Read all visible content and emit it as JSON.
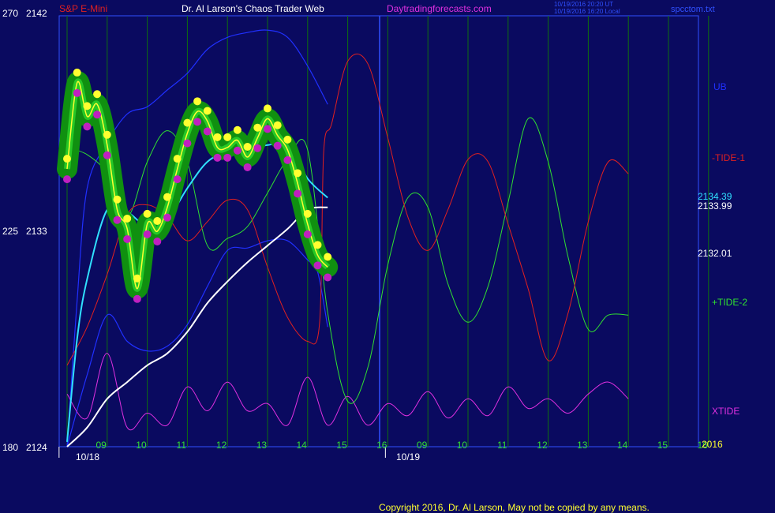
{
  "header": {
    "symbol": "S&P E-Mini",
    "title": "Dr. Al Larson's Chaos Trader Web",
    "site": "Daytradingforecasts.com",
    "ts_line1": "10/19/2016 20:20 UT",
    "ts_line2": "10/19/2016 16:20 Local",
    "file": "spcctom.txt"
  },
  "footer": {
    "copyright": "Copyright 2016, Dr. Al Larson, May not be copied by any means."
  },
  "colors": {
    "background": "#0a0a60",
    "frame": "#3050ff",
    "grid": "#0f6f0f",
    "tide1": "#e02020",
    "tide2": "#30e030",
    "xtide": "#e030e0",
    "band": "#2030ff",
    "cyan_avg": "#30e0ff",
    "white_avg": "#ffffff",
    "yellow": "#ffff30"
  },
  "chart_data": {
    "type": "line",
    "title": "S&P E-Mini",
    "left_axis": {
      "ticks": [
        {
          "index": "270",
          "price": "2142",
          "value": 2142
        },
        {
          "index": "225",
          "price": "2133",
          "value": 2133
        },
        {
          "index": "180",
          "price": "2124",
          "value": 2124
        }
      ],
      "ylim": [
        2124,
        2142
      ]
    },
    "x_hours": [
      "09",
      "10",
      "11",
      "12",
      "13",
      "14",
      "15",
      "16",
      "09",
      "10",
      "11",
      "12",
      "13",
      "14",
      "15",
      "16"
    ],
    "x_dates": [
      "10/18",
      "10/19"
    ],
    "year": "2016",
    "right_labels": {
      "ub": "UB",
      "tide1": "-TIDE-1",
      "price1": "2134.39",
      "price2": "2133.99",
      "price3": "2132.01",
      "tide2": "+TIDE-2",
      "xtide": "XTIDE"
    },
    "series": [
      {
        "name": "S&P E-Mini",
        "points": [
          [
            0.0,
            2135.6
          ],
          [
            0.25,
            2139.2
          ],
          [
            0.5,
            2137.8
          ],
          [
            0.75,
            2138.3
          ],
          [
            1.0,
            2136.6
          ],
          [
            1.25,
            2133.9
          ],
          [
            1.5,
            2133.1
          ],
          [
            1.75,
            2130.6
          ],
          [
            2.0,
            2133.3
          ],
          [
            2.25,
            2133.0
          ],
          [
            2.5,
            2134.0
          ],
          [
            2.75,
            2135.6
          ],
          [
            3.0,
            2137.1
          ],
          [
            3.25,
            2138.0
          ],
          [
            3.5,
            2137.6
          ],
          [
            3.75,
            2136.5
          ],
          [
            4.0,
            2136.5
          ],
          [
            4.25,
            2136.8
          ],
          [
            4.5,
            2136.1
          ],
          [
            4.75,
            2136.9
          ],
          [
            5.0,
            2137.7
          ],
          [
            5.25,
            2137.0
          ],
          [
            5.5,
            2136.4
          ],
          [
            5.75,
            2135.0
          ],
          [
            6.0,
            2133.3
          ],
          [
            6.25,
            2132.0
          ],
          [
            6.5,
            2131.5
          ]
        ]
      },
      {
        "name": "-TIDE-1",
        "points": [
          [
            0.0,
            2127.4
          ],
          [
            0.5,
            2129.0
          ],
          [
            1.0,
            2131.2
          ],
          [
            1.5,
            2133.7
          ],
          [
            2.0,
            2134.1
          ],
          [
            2.5,
            2133.6
          ],
          [
            3.0,
            2132.6
          ],
          [
            3.5,
            2133.4
          ],
          [
            4.0,
            2134.3
          ],
          [
            4.5,
            2133.9
          ],
          [
            5.0,
            2131.5
          ],
          [
            5.5,
            2129.4
          ],
          [
            6.0,
            2128.4
          ],
          [
            6.3,
            2129.2
          ],
          [
            6.4,
            2136.3
          ],
          [
            6.6,
            2137.5
          ],
          [
            7.0,
            2140.1
          ],
          [
            7.5,
            2140.0
          ],
          [
            8.0,
            2136.9
          ],
          [
            8.5,
            2133.6
          ],
          [
            9.0,
            2132.2
          ],
          [
            9.5,
            2133.9
          ],
          [
            10.0,
            2136.0
          ],
          [
            10.5,
            2135.9
          ],
          [
            11.0,
            2133.3
          ],
          [
            11.5,
            2130.6
          ],
          [
            12.0,
            2127.6
          ],
          [
            12.5,
            2129.6
          ],
          [
            13.0,
            2133.4
          ],
          [
            13.5,
            2135.9
          ],
          [
            14.0,
            2135.4
          ]
        ]
      },
      {
        "name": "+TIDE-2",
        "points": [
          [
            0.0,
            2136.5
          ],
          [
            0.5,
            2136.2
          ],
          [
            1.0,
            2135.4
          ],
          [
            1.5,
            2133.6
          ],
          [
            2.0,
            2135.9
          ],
          [
            2.5,
            2137.2
          ],
          [
            3.0,
            2135.9
          ],
          [
            3.5,
            2132.4
          ],
          [
            4.0,
            2132.7
          ],
          [
            4.5,
            2133.2
          ],
          [
            5.0,
            2134.6
          ],
          [
            5.5,
            2136.0
          ],
          [
            6.0,
            2136.4
          ],
          [
            6.5,
            2129.6
          ],
          [
            7.0,
            2125.9
          ],
          [
            7.5,
            2127.3
          ],
          [
            8.0,
            2131.6
          ],
          [
            8.5,
            2134.4
          ],
          [
            9.0,
            2134.0
          ],
          [
            9.5,
            2130.8
          ],
          [
            10.0,
            2129.2
          ],
          [
            10.5,
            2130.7
          ],
          [
            11.0,
            2134.2
          ],
          [
            11.5,
            2137.7
          ],
          [
            12.0,
            2135.9
          ],
          [
            12.5,
            2131.9
          ],
          [
            13.0,
            2128.9
          ],
          [
            13.5,
            2129.5
          ],
          [
            14.0,
            2129.5
          ]
        ]
      },
      {
        "name": "XTIDE",
        "points": [
          [
            0.0,
            2126.2
          ],
          [
            0.5,
            2125.2
          ],
          [
            1.0,
            2127.9
          ],
          [
            1.5,
            2124.8
          ],
          [
            2.0,
            2125.4
          ],
          [
            2.5,
            2124.9
          ],
          [
            3.0,
            2126.5
          ],
          [
            3.5,
            2125.5
          ],
          [
            4.0,
            2126.7
          ],
          [
            4.5,
            2125.5
          ],
          [
            5.0,
            2125.8
          ],
          [
            5.5,
            2124.9
          ],
          [
            6.0,
            2126.9
          ],
          [
            6.5,
            2124.9
          ],
          [
            7.0,
            2126.1
          ],
          [
            7.5,
            2124.9
          ],
          [
            8.0,
            2125.8
          ],
          [
            8.5,
            2125.3
          ],
          [
            9.0,
            2126.3
          ],
          [
            9.5,
            2125.2
          ],
          [
            10.0,
            2126.0
          ],
          [
            10.5,
            2125.3
          ],
          [
            11.0,
            2126.5
          ],
          [
            11.5,
            2125.6
          ],
          [
            12.0,
            2126.0
          ],
          [
            12.5,
            2125.4
          ],
          [
            13.0,
            2126.2
          ],
          [
            13.5,
            2126.7
          ],
          [
            14.0,
            2126.0
          ]
        ]
      },
      {
        "name": "UB",
        "points": [
          [
            0.0,
            2124.0
          ],
          [
            0.25,
            2130.1
          ],
          [
            0.5,
            2134.8
          ],
          [
            1.0,
            2136.7
          ],
          [
            1.5,
            2137.9
          ],
          [
            2.0,
            2138.2
          ],
          [
            2.5,
            2138.9
          ],
          [
            3.0,
            2139.6
          ],
          [
            3.5,
            2140.6
          ],
          [
            4.0,
            2141.1
          ],
          [
            4.5,
            2141.3
          ],
          [
            5.0,
            2141.4
          ],
          [
            5.5,
            2141.1
          ],
          [
            6.0,
            2139.9
          ],
          [
            6.5,
            2138.3
          ]
        ]
      },
      {
        "name": "LB",
        "points": [
          [
            0.0,
            2124.0
          ],
          [
            0.5,
            2127.0
          ],
          [
            1.0,
            2129.5
          ],
          [
            1.5,
            2128.4
          ],
          [
            2.0,
            2128.0
          ],
          [
            2.5,
            2128.2
          ],
          [
            3.0,
            2129.1
          ],
          [
            3.5,
            2130.7
          ],
          [
            4.0,
            2132.2
          ],
          [
            4.5,
            2132.3
          ],
          [
            5.0,
            2132.6
          ],
          [
            5.5,
            2132.6
          ],
          [
            6.0,
            2131.8
          ],
          [
            6.25,
            2131.3
          ],
          [
            6.5,
            2129.0
          ]
        ]
      },
      {
        "name": "cyan-average",
        "points": [
          [
            0.0,
            2124.2
          ],
          [
            0.25,
            2128.5
          ],
          [
            0.5,
            2131.0
          ],
          [
            1.0,
            2133.9
          ],
          [
            1.5,
            2133.8
          ],
          [
            2.0,
            2133.2
          ],
          [
            2.5,
            2133.5
          ],
          [
            3.0,
            2134.8
          ],
          [
            3.5,
            2135.9
          ],
          [
            4.0,
            2136.3
          ],
          [
            4.5,
            2136.4
          ],
          [
            5.0,
            2136.6
          ],
          [
            5.5,
            2136.6
          ],
          [
            6.0,
            2135.2
          ],
          [
            6.5,
            2134.4
          ]
        ]
      },
      {
        "name": "white-average",
        "points": [
          [
            0.0,
            2124.0
          ],
          [
            0.5,
            2124.8
          ],
          [
            1.0,
            2126.0
          ],
          [
            1.5,
            2126.7
          ],
          [
            2.0,
            2127.4
          ],
          [
            2.5,
            2127.9
          ],
          [
            3.0,
            2128.8
          ],
          [
            3.5,
            2130.0
          ],
          [
            4.0,
            2130.9
          ],
          [
            4.5,
            2131.7
          ],
          [
            5.0,
            2132.4
          ],
          [
            5.5,
            2133.1
          ],
          [
            6.0,
            2133.9
          ],
          [
            6.5,
            2134.0
          ]
        ]
      }
    ]
  }
}
